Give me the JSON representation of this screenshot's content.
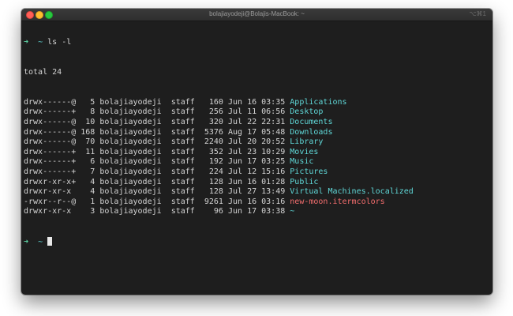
{
  "window": {
    "title": "bolajiayodeji@Bolajis-MacBook: ~",
    "shortcut": "⌥⌘1"
  },
  "prompt": {
    "arrow": "➜",
    "dir": "~",
    "command": "ls -l"
  },
  "output": {
    "total": "total 24",
    "entries": [
      {
        "perm": "drwx------@",
        "links": "5",
        "owner": "bolajiayodeji",
        "group": "staff",
        "size": "160",
        "month": "Jun",
        "day": "16",
        "time": "03:35",
        "name": "Applications",
        "color": "#5fd7d7"
      },
      {
        "perm": "drwx------+",
        "links": "8",
        "owner": "bolajiayodeji",
        "group": "staff",
        "size": "256",
        "month": "Jul",
        "day": "11",
        "time": "06:56",
        "name": "Desktop",
        "color": "#5fd7d7"
      },
      {
        "perm": "drwx------@",
        "links": "10",
        "owner": "bolajiayodeji",
        "group": "staff",
        "size": "320",
        "month": "Jul",
        "day": "22",
        "time": "22:31",
        "name": "Documents",
        "color": "#5fd7d7"
      },
      {
        "perm": "drwx------@",
        "links": "168",
        "owner": "bolajiayodeji",
        "group": "staff",
        "size": "5376",
        "month": "Aug",
        "day": "17",
        "time": "05:48",
        "name": "Downloads",
        "color": "#5fd7d7"
      },
      {
        "perm": "drwx------@",
        "links": "70",
        "owner": "bolajiayodeji",
        "group": "staff",
        "size": "2240",
        "month": "Jul",
        "day": "20",
        "time": "20:52",
        "name": "Library",
        "color": "#5fd7d7"
      },
      {
        "perm": "drwx------+",
        "links": "11",
        "owner": "bolajiayodeji",
        "group": "staff",
        "size": "352",
        "month": "Jul",
        "day": "23",
        "time": "10:29",
        "name": "Movies",
        "color": "#5fd7d7"
      },
      {
        "perm": "drwx------+",
        "links": "6",
        "owner": "bolajiayodeji",
        "group": "staff",
        "size": "192",
        "month": "Jun",
        "day": "17",
        "time": "03:25",
        "name": "Music",
        "color": "#5fd7d7"
      },
      {
        "perm": "drwx------+",
        "links": "7",
        "owner": "bolajiayodeji",
        "group": "staff",
        "size": "224",
        "month": "Jul",
        "day": "12",
        "time": "15:16",
        "name": "Pictures",
        "color": "#5fd7d7"
      },
      {
        "perm": "drwxr-xr-x+",
        "links": "4",
        "owner": "bolajiayodeji",
        "group": "staff",
        "size": "128",
        "month": "Jun",
        "day": "16",
        "time": "01:28",
        "name": "Public",
        "color": "#5fd7d7"
      },
      {
        "perm": "drwxr-xr-x",
        "links": "4",
        "owner": "bolajiayodeji",
        "group": "staff",
        "size": "128",
        "month": "Jul",
        "day": "27",
        "time": "13:49",
        "name": "Virtual Machines.localized",
        "color": "#5fd7d7"
      },
      {
        "perm": "-rwxr--r--@",
        "links": "1",
        "owner": "bolajiayodeji",
        "group": "staff",
        "size": "9261",
        "month": "Jun",
        "day": "16",
        "time": "03:16",
        "name": "new-moon.itermcolors",
        "color": "#f26d6d"
      },
      {
        "perm": "drwxr-xr-x",
        "links": "3",
        "owner": "bolajiayodeji",
        "group": "staff",
        "size": "96",
        "month": "Jun",
        "day": "17",
        "time": "03:38",
        "name": "~",
        "color": "#5fd7d7"
      }
    ]
  },
  "colors": {
    "background": "#1e1e1e",
    "text": "#d4d4d4",
    "directory": "#5fd7d7",
    "file": "#f26d6d",
    "arrow": "#5fd7a7"
  }
}
